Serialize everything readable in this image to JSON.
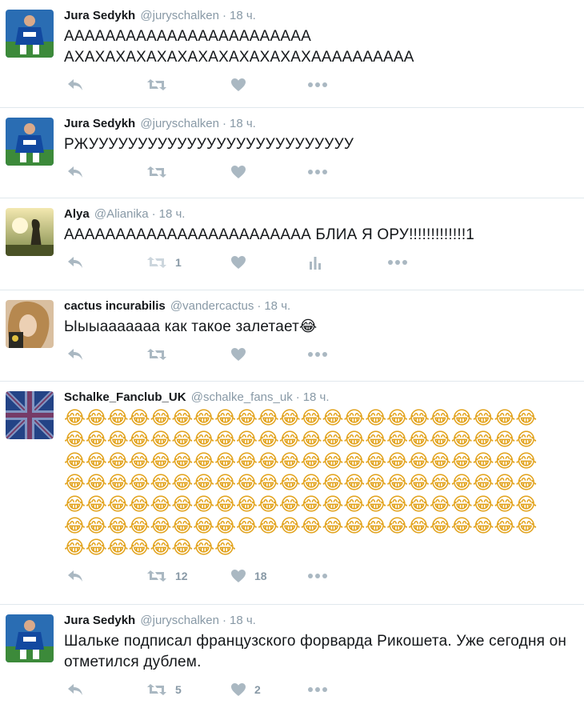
{
  "colors": {
    "text": "#14171a",
    "muted": "#8899a6",
    "icon": "#aab8c2",
    "divider": "#e1e8ed"
  },
  "tweets": [
    {
      "name": "Jura Sedykh",
      "handle": "@juryschalken",
      "time": "18 ч.",
      "lines": [
        "АААААААААААААААААААААААА",
        "АХАХАХАХАХАХАХАХАХАХАХАХАААААААААА"
      ],
      "retweets": "",
      "likes": "",
      "avatar_icon": "footballer-avatar",
      "has_stats": false
    },
    {
      "name": "Jura Sedykh",
      "handle": "@juryschalken",
      "time": "18 ч.",
      "lines": [
        "РЖУУУУУУУУУУУУУУУУУУУУУУУУУУУ"
      ],
      "retweets": "",
      "likes": "",
      "avatar_icon": "footballer-avatar",
      "has_stats": false
    },
    {
      "name": "Alya",
      "handle": "@Alianika",
      "time": "18 ч.",
      "lines": [
        "АААААААААААААААААААААААА БЛИА Я ОРУ!!!!!!!!!!!!!1"
      ],
      "retweets": "1",
      "likes": "",
      "avatar_icon": "sunset-silhouette-avatar",
      "has_stats": true
    },
    {
      "name": "cactus incurabilis",
      "handle": "@vandercactus",
      "time": "18 ч.",
      "lines": [
        "Ыыыааааааа как такое залетает😂"
      ],
      "retweets": "",
      "likes": "",
      "avatar_icon": "girl-portrait-avatar",
      "has_stats": false
    },
    {
      "name": "Schalke_Fanclub_UK",
      "handle": "@schalke_fans_uk",
      "time": "18 ч.",
      "lines": [
        "😂😂😂😂😂😂😂😂😂😂😂😂😂😂😂😂😂😂😂😂😂😂",
        "😂😂😂😂😂😂😂😂😂😂😂😂😂😂😂😂😂😂😂😂😂😂",
        "😂😂😂😂😂😂😂😂😂😂😂😂😂😂😂😂😂😂😂😂😂😂",
        "😂😂😂😂😂😂😂😂😂😂😂😂😂😂😂😂😂😂😂😂😂😂",
        "😂😂😂😂😂😂😂😂😂😂😂😂😂😂😂😂😂😂😂😂😂😂",
        "😂😂😂😂😂😂😂😂😂😂😂😂😂😂😂😂😂😂😂😂😂😂",
        "😂😂😂😂😂😂😂😂"
      ],
      "retweets": "12",
      "likes": "18",
      "avatar_icon": "union-flag-fanclub-avatar",
      "has_stats": false
    },
    {
      "name": "Jura Sedykh",
      "handle": "@juryschalken",
      "time": "18 ч.",
      "lines": [
        "Шальке подписал французского форварда Рикошета. Уже сегодня он",
        "отметился дублем."
      ],
      "retweets": "5",
      "likes": "2",
      "avatar_icon": "footballer-avatar",
      "has_stats": false
    }
  ]
}
